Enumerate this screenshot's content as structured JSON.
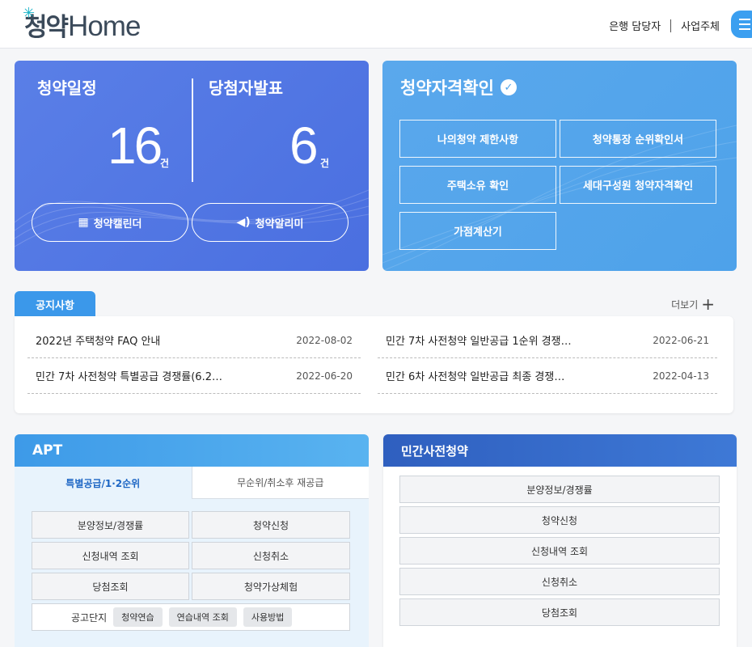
{
  "header": {
    "logo_ko": "청약",
    "logo_en": "Home",
    "links": [
      "은행 담당자",
      "사업주체"
    ]
  },
  "schedule": {
    "left_title": "청약일정",
    "left_count": "16",
    "right_title": "당첨자발표",
    "right_count": "6",
    "unit": "건",
    "calendar_btn": "청약캘린더",
    "alarm_btn": "청약알리미"
  },
  "qualification": {
    "title": "청약자격확인",
    "buttons": [
      "나의청약 제한사항",
      "청약통장 순위확인서",
      "주택소유 확인",
      "세대구성원 청약자격확인",
      "가점계산기"
    ]
  },
  "notice": {
    "tab": "공지사항",
    "more": "더보기",
    "items": [
      {
        "title": "2022년 주택청약 FAQ 안내",
        "date": "2022-08-02"
      },
      {
        "title": "민간 7차 사전청약 일반공급 1순위 경쟁…",
        "date": "2022-06-21"
      },
      {
        "title": "민간 7차 사전청약 특별공급 경쟁률(6.2…",
        "date": "2022-06-20"
      },
      {
        "title": "민간 6차 사전청약 일반공급 최종 경쟁…",
        "date": "2022-04-13"
      }
    ]
  },
  "apt": {
    "title": "APT",
    "tabs": [
      "특별공급/1·2순위",
      "무순위/취소후 재공급"
    ],
    "buttons": [
      "분양정보/경쟁률",
      "청약신청",
      "신청내역 조회",
      "신청취소",
      "당첨조회",
      "청약가상체험"
    ],
    "complex_label": "공고단지",
    "chips": [
      "청약연습",
      "연습내역 조회",
      "사용방법"
    ]
  },
  "private": {
    "title": "민간사전청약",
    "buttons": [
      "분양정보/경쟁률",
      "청약신청",
      "신청내역 조회",
      "신청취소",
      "당첨조회"
    ]
  }
}
